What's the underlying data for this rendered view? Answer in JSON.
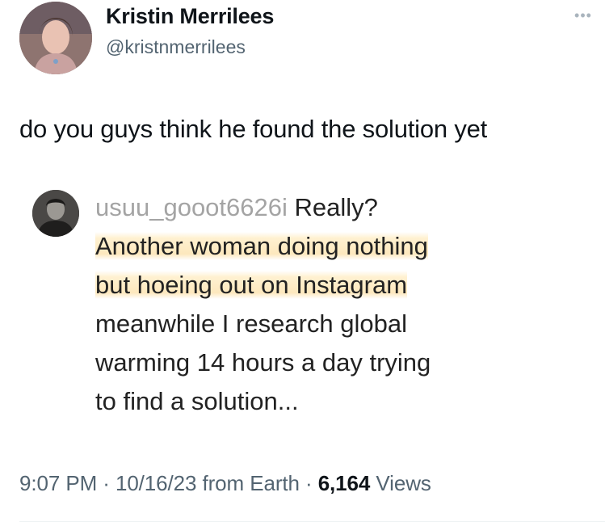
{
  "author": {
    "display_name": "Kristin Merrilees",
    "handle": "@kristnmerrilees"
  },
  "more_icon": "more-horizontal-icon",
  "tweet": {
    "text": "do you guys think he found the solution yet"
  },
  "quoted": {
    "username": "usuu_gooot6626i",
    "opening": "Really?",
    "lines": [
      "Another woman doing nothing",
      "but hoeing out on Instagram",
      "meanwhile I research global",
      "warming 14 hours a day trying",
      "to find a solution..."
    ]
  },
  "meta": {
    "time": "9:07 PM",
    "sep1": "·",
    "date": "10/16/23",
    "source": "from Earth",
    "sep2": "·",
    "views_count": "6,164",
    "views_label": "Views"
  },
  "colors": {
    "highlight": "#fde8bd",
    "secondary_text": "#536471",
    "username_gray": "#a4a4a4"
  }
}
